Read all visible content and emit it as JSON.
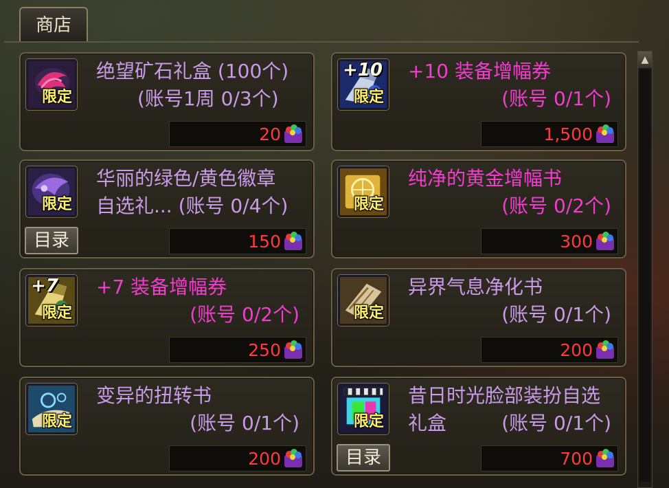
{
  "shop": {
    "tab_label": "商店",
    "catalog_label": "目录",
    "badge_label": "限定",
    "scroll_up": "▲"
  },
  "items": [
    {
      "name": "绝望矿石礼盒 (100个)",
      "sub": "(账号1周 0/3个)",
      "price": "20",
      "name_color": "lavender",
      "icon": "pink-claw-box-icon"
    },
    {
      "name": "+10 装备增幅券",
      "sub": "(账号 0/1个)",
      "price": "1,500",
      "name_color": "magenta",
      "icon": "plus10-amplify-ticket-icon",
      "icon_plus": "+10"
    },
    {
      "name": "华丽的绿色/黄色徽章",
      "name2": "自选礼... (账号 0/4个)",
      "price": "150",
      "name_color": "lavender",
      "icon": "purple-emblem-box-icon"
    },
    {
      "name": "纯净的黄金增幅书",
      "sub": "(账号 0/2个)",
      "price": "300",
      "name_color": "magenta",
      "icon": "golden-amplify-book-icon"
    },
    {
      "name": "+7 装备增幅券",
      "sub": "(账号 0/2个)",
      "price": "250",
      "name_color": "magenta",
      "icon": "plus7-amplify-ticket-icon",
      "icon_plus": "+7"
    },
    {
      "name": "异界气息净化书",
      "sub": "(账号 0/1个)",
      "price": "200",
      "name_color": "lavender",
      "icon": "purify-scroll-icon"
    },
    {
      "name": "变异的扭转书",
      "sub": "(账号 0/1个)",
      "price": "200",
      "name_color": "lavender",
      "icon": "twist-book-icon"
    },
    {
      "name": "昔日时光脸部装扮自选",
      "name2": "礼盒",
      "sub2": "(账号 0/1个)",
      "price": "700",
      "name_color": "lavender",
      "icon": "face-costume-box-icon"
    }
  ],
  "colors": {
    "lavender": "#c99ae8",
    "magenta": "#f23ccf",
    "price": "#ff3b3b",
    "badge": "#fff26a"
  }
}
